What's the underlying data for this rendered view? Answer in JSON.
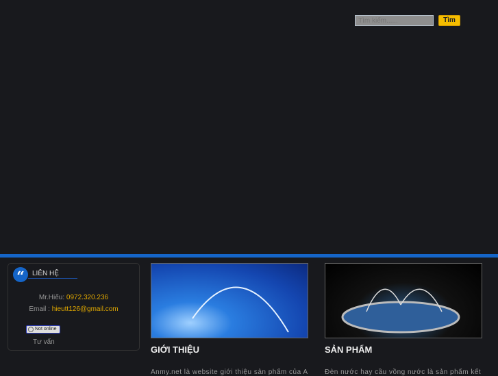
{
  "search": {
    "placeholder": "Tìm kiếm......",
    "button": "Tìm"
  },
  "contact": {
    "title": "LIÊN HỆ",
    "name_label": "Mr.Hiếu: ",
    "phone": "0972.320.236",
    "email_label": "Email : ",
    "email": "hieutt126@gmail.com",
    "status": "Not online",
    "consult": "Tư vấn"
  },
  "sections": [
    {
      "title": "GIỚI THIỆU",
      "text": "Anmy.net là website giới thiệu sản phẩm của An"
    },
    {
      "title": "SẢN PHẨM",
      "text": "Đèn nước hay cầu vồng nước là sản phẩm kết"
    }
  ]
}
